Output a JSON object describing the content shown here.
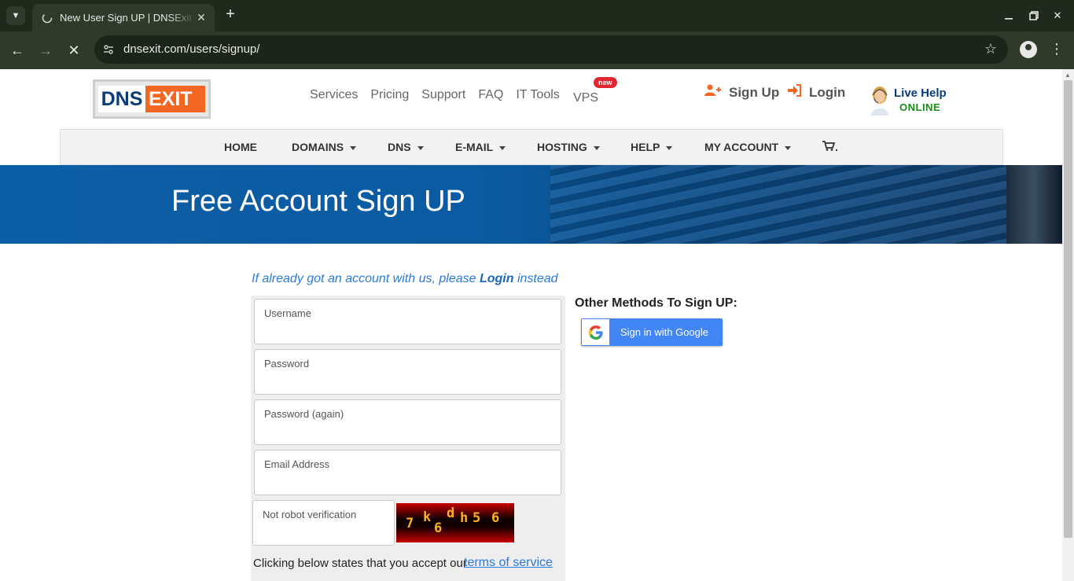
{
  "browser": {
    "tab_title": "New User Sign UP | DNSExit",
    "url": "dnsexit.com/users/signup/",
    "new_tab_symbol": "+",
    "icons": {
      "tab_list": "chevron-down-icon",
      "favicon": "loading-icon",
      "tab_close": "close-icon",
      "back": "back-arrow-icon",
      "forward": "forward-arrow-icon",
      "stop": "stop-icon",
      "site_info": "tune-icon",
      "bookmark": "star-icon",
      "profile": "profile-icon",
      "menu": "kebab-menu-icon",
      "minimize": "minimize-icon",
      "maximize": "restore-icon",
      "close": "close-window-icon"
    }
  },
  "header": {
    "logo_left": "DNS",
    "logo_right": "EXIT",
    "top_links": [
      "Services",
      "Pricing",
      "Support",
      "FAQ",
      "IT Tools"
    ],
    "vps_label": "VPS",
    "vps_badge": "new",
    "signup_label": "Sign Up",
    "login_label": "Login",
    "live_help_title": "Live Help",
    "live_help_status": "ONLINE"
  },
  "main_nav": {
    "home": "HOME",
    "domains": "DOMAINS",
    "dns": "DNS",
    "email": "E-MAIL",
    "hosting": "HOSTING",
    "help": "HELP",
    "my_account": "MY ACCOUNT",
    "cart_suffix": "."
  },
  "banner": {
    "title": "Free Account Sign UP"
  },
  "form": {
    "login_hint_prefix": "If already got an account with us, please ",
    "login_hint_link": "Login",
    "login_hint_suffix": " instead",
    "username_placeholder": "Username",
    "password_placeholder": "Password",
    "password_again_placeholder": "Password (again)",
    "email_placeholder": "Email Address",
    "captcha_placeholder": "Not robot verification",
    "captcha_chars": [
      "7",
      "k",
      "6",
      "d",
      "h",
      "5",
      "6"
    ],
    "accept_text": "Clicking below states that you accept our",
    "tos_link": "terms of service"
  },
  "other_methods": {
    "title": "Other Methods To Sign UP:",
    "google_button": "Sign in with Google"
  },
  "colors": {
    "brand_orange": "#f26722",
    "brand_blue": "#0b3c7a",
    "banner_blue": "#0c5ea6",
    "link_blue": "#2b7bd9",
    "google_blue": "#4285f4",
    "online_green": "#1a8a1a",
    "badge_red": "#e3262f"
  }
}
